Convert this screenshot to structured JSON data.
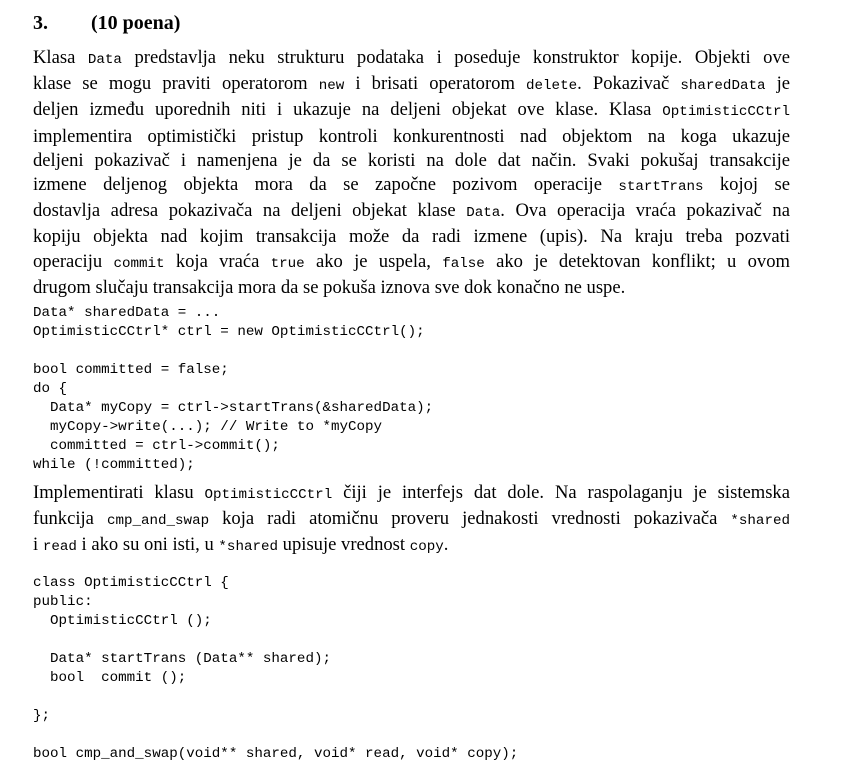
{
  "heading": {
    "number": "3.",
    "points": "(10 poena)"
  },
  "intro": [
    [
      {
        "t": "Klasa "
      },
      {
        "c": "Data"
      },
      {
        "t": " predstavlja neku strukturu podataka i poseduje konstruktor kopije. Objekti ove"
      }
    ],
    [
      {
        "t": "klase se mogu praviti operatorom "
      },
      {
        "c": "new"
      },
      {
        "t": " i brisati operatorom "
      },
      {
        "c": "delete"
      },
      {
        "t": ". Pokazivač "
      },
      {
        "c": "sharedData"
      },
      {
        "t": " je"
      }
    ],
    [
      {
        "t": "deljen između uporednih niti i ukazuje na deljeni objekat ove klase. Klasa "
      },
      {
        "c": "OptimisticCCtrl"
      }
    ],
    [
      {
        "t": "implementira optimistički pristup kontroli konkurentnosti nad objektom na koga ukazuje"
      }
    ],
    [
      {
        "t": "deljeni pokazivač i namenjena je da se koristi na dole dat način. Svaki pokušaj transakcije"
      }
    ],
    [
      {
        "t": "izmene deljenog objekta mora da se započne pozivom operacije "
      },
      {
        "c": "startTrans"
      },
      {
        "t": " kojoj se"
      }
    ],
    [
      {
        "t": "dostavlja adresa pokazivača na deljeni objekat klase "
      },
      {
        "c": "Data"
      },
      {
        "t": ". Ova operacija vraća pokazivač na"
      }
    ],
    [
      {
        "t": "kopiju objekta nad kojim transakcija može da radi izmene (upis). Na kraju treba pozvati"
      }
    ],
    [
      {
        "t": "operaciju "
      },
      {
        "c": "commit"
      },
      {
        "t": " koja vraća "
      },
      {
        "c": "true"
      },
      {
        "t": " ako je uspela, "
      },
      {
        "c": "false"
      },
      {
        "t": " ako je detektovan konflikt; u ovom"
      }
    ],
    [
      {
        "t": "drugom slučaju transakcija mora da se pokuša iznova sve dok konačno ne uspe."
      }
    ]
  ],
  "code_usage": [
    "Data* sharedData = ...",
    "OptimisticCCtrl* ctrl = new OptimisticCCtrl();",
    "",
    "bool committed = false;",
    "do {",
    "  Data* myCopy = ctrl->startTrans(&sharedData);",
    "  myCopy->write(...); // Write to *myCopy",
    "  committed = ctrl->commit();",
    "while (!committed);"
  ],
  "task": [
    [
      {
        "t": "Implementirati klasu "
      },
      {
        "c": "OptimisticCCtrl"
      },
      {
        "t": " čiji je interfejs dat dole. Na raspolaganju je sistemska"
      }
    ],
    [
      {
        "t": "funkcija "
      },
      {
        "c": "cmp_and_swap"
      },
      {
        "t": " koja radi atomičnu proveru jednakosti vrednosti pokazivača "
      },
      {
        "c": "*shared"
      }
    ],
    [
      {
        "t": "i "
      },
      {
        "c": "read"
      },
      {
        "t": " i ako su oni isti, u "
      },
      {
        "c": "*shared"
      },
      {
        "t": " upisuje vrednost "
      },
      {
        "c": "copy"
      },
      {
        "t": "."
      }
    ]
  ],
  "code_interface": [
    "class OptimisticCCtrl {",
    "public:",
    "  OptimisticCCtrl ();",
    "",
    "  Data* startTrans (Data** shared);",
    "  bool  commit ();",
    "",
    "};",
    "",
    "bool cmp_and_swap(void** shared, void* read, void* copy);"
  ]
}
